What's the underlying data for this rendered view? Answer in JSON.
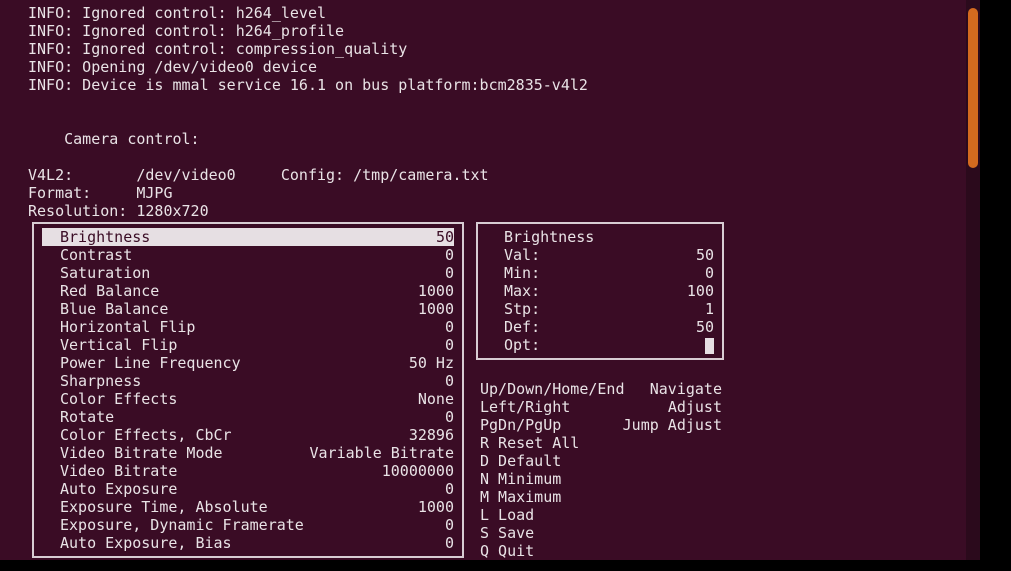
{
  "log": [
    "INFO: Ignored control: h264_level",
    "INFO: Ignored control: h264_profile",
    "INFO: Ignored control: compression_quality",
    "INFO: Opening /dev/video0 device",
    "INFO: Device is mmal service 16.1 on bus platform:bcm2835-v4l2"
  ],
  "header": {
    "title": "Camera control:",
    "v4l2_label": "V4L2:",
    "v4l2_value": "/dev/video0",
    "config_label": "Config:",
    "config_value": "/tmp/camera.txt",
    "format_label": "Format:",
    "format_value": "MJPG",
    "res_label": "Resolution:",
    "res_value": "1280x720"
  },
  "controls": [
    {
      "name": "Brightness",
      "value": "50",
      "selected": true
    },
    {
      "name": "Contrast",
      "value": "0"
    },
    {
      "name": "Saturation",
      "value": "0"
    },
    {
      "name": "Red Balance",
      "value": "1000"
    },
    {
      "name": "Blue Balance",
      "value": "1000"
    },
    {
      "name": "Horizontal Flip",
      "value": "0"
    },
    {
      "name": "Vertical Flip",
      "value": "0"
    },
    {
      "name": "Power Line Frequency",
      "value": "50 Hz"
    },
    {
      "name": "Sharpness",
      "value": "0"
    },
    {
      "name": "Color Effects",
      "value": "None"
    },
    {
      "name": "Rotate",
      "value": "0"
    },
    {
      "name": "Color Effects, CbCr",
      "value": "32896"
    },
    {
      "name": "Video Bitrate Mode",
      "value": "Variable Bitrate"
    },
    {
      "name": "Video Bitrate",
      "value": "10000000"
    },
    {
      "name": "Auto Exposure",
      "value": "0"
    },
    {
      "name": "Exposure Time, Absolute",
      "value": "1000"
    },
    {
      "name": "Exposure, Dynamic Framerate",
      "value": "0"
    },
    {
      "name": "Auto Exposure, Bias",
      "value": "0"
    }
  ],
  "detail": {
    "title": "Brightness",
    "rows": [
      {
        "k": "Val:",
        "v": "50"
      },
      {
        "k": "Min:",
        "v": "0"
      },
      {
        "k": "Max:",
        "v": "100"
      },
      {
        "k": "Stp:",
        "v": "1"
      },
      {
        "k": "Def:",
        "v": "50"
      },
      {
        "k": "Opt:",
        "v": ""
      }
    ]
  },
  "help": {
    "nav": [
      {
        "l": "Up/Down/Home/End",
        "r": "Navigate"
      },
      {
        "l": "Left/Right",
        "r": "Adjust"
      },
      {
        "l": "PgDn/PgUp",
        "r": "Jump Adjust"
      }
    ],
    "cmds": [
      "R Reset All",
      "D Default",
      "N Minimum",
      "M Maximum",
      "L Load",
      "S Save",
      "Q Quit"
    ]
  }
}
